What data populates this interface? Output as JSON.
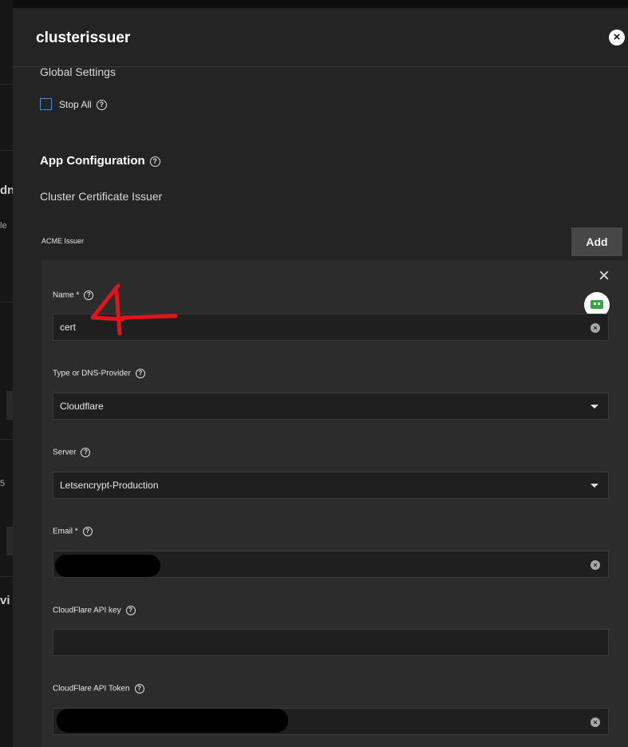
{
  "window": {
    "title": "clusterissuer"
  },
  "background": {
    "fragments": [
      "dn",
      "le",
      "5",
      "vi"
    ]
  },
  "global_settings": {
    "label": "Global Settings",
    "stop_all_label": "Stop All"
  },
  "app_configuration": {
    "title": "App Configuration",
    "subtitle": "Cluster Certificate Issuer",
    "acme_issuer_label": "ACME Issuer",
    "add_label": "Add"
  },
  "fields": {
    "name": {
      "label": "Name *",
      "value": "cert"
    },
    "type": {
      "label": "Type or DNS-Provider",
      "value": "Cloudflare"
    },
    "server": {
      "label": "Server",
      "value": "Letsencrypt-Production"
    },
    "email": {
      "label": "Email *",
      "value": ""
    },
    "api_key": {
      "label": "CloudFlare API key",
      "value": ""
    },
    "api_token": {
      "label": "CloudFlare API Token",
      "value": ""
    }
  },
  "icons": {
    "help": "?",
    "close": "×",
    "clear": "×"
  },
  "annotation": {
    "color": "#e0141b"
  },
  "colors": {
    "checkbox_border": "#3a8fd8",
    "robot": "#36a642"
  }
}
